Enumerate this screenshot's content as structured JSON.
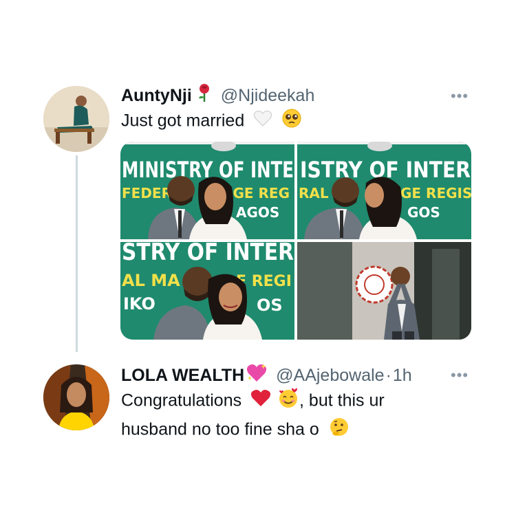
{
  "tweet1": {
    "display_name": "AuntyNji",
    "name_emoji": "rose",
    "handle": "@Njideekah",
    "text": "Just got married",
    "text_emojis": [
      "white-heart",
      "pleading-face"
    ],
    "more": "•••",
    "media": [
      {
        "sign_line1": "MINISTRY OF INTE",
        "sign_line2": "FEDERAL",
        "sign_line3": "AGE REG",
        "sign_line4": "AGOS"
      },
      {
        "sign_line1": "ISTRY OF INTER",
        "sign_line2": "RAL",
        "sign_line3": "GE REGIS",
        "sign_line4": "GOS"
      },
      {
        "sign_line1": "STRY OF INTER",
        "sign_line2": "AL MA",
        "sign_line3": "E REGI",
        "sign_line4": "IKO",
        "sign_line5": "OS"
      },
      {
        "sign_line1": ""
      }
    ]
  },
  "tweet2": {
    "display_name": "LOLA WEALTH",
    "name_emoji": "sparkling-heart",
    "handle": "@AAjebowale",
    "separator": "·",
    "time": "1h",
    "more": "•••",
    "text_line1_a": "Congratulations",
    "text_line1_b": ", but this ur",
    "text_line2": "husband no too fine sha o",
    "text_emojis": [
      "red-heart",
      "smiling-face-with-hearts",
      "thinking-face"
    ]
  },
  "colors": {
    "text": "#0f1419",
    "secondary": "#536471",
    "thread_line": "#cfd9de",
    "sign_green": "#1f8a6e",
    "sign_yellow": "#f2e04a"
  }
}
